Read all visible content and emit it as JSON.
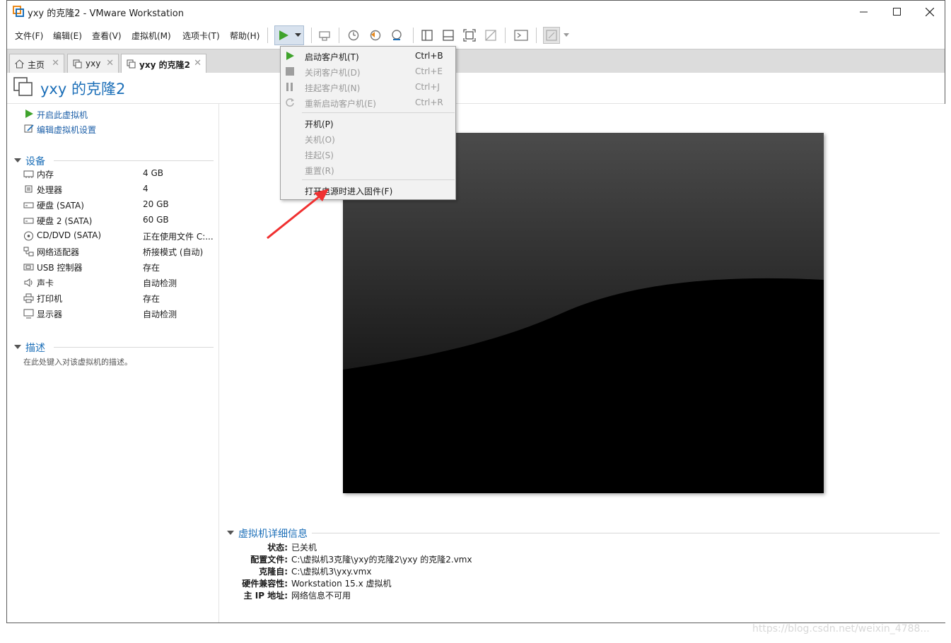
{
  "window": {
    "title": "yxy 的克隆2 - VMware Workstation",
    "minimize": "—",
    "maximize": "☐",
    "close": "✕"
  },
  "menubar": {
    "items": [
      "文件(F)",
      "编辑(E)",
      "查看(V)",
      "虚拟机(M)",
      "选项卡(T)",
      "帮助(H)"
    ]
  },
  "tabs": [
    {
      "label": "主页",
      "close": "✕"
    },
    {
      "label": "yxy",
      "close": "✕"
    },
    {
      "label": "yxy 的克隆2",
      "close": "✕"
    }
  ],
  "vm": {
    "title": "yxy 的克隆2"
  },
  "actions": {
    "power_on": "开启此虚拟机",
    "edit_settings": "编辑虚拟机设置"
  },
  "devices": {
    "heading": "设备",
    "rows": [
      {
        "name": "内存",
        "value": "4 GB",
        "icon": "memory-icon"
      },
      {
        "name": "处理器",
        "value": "4",
        "icon": "cpu-icon"
      },
      {
        "name": "硬盘 (SATA)",
        "value": "20 GB",
        "icon": "disk-icon"
      },
      {
        "name": "硬盘 2 (SATA)",
        "value": "60 GB",
        "icon": "disk-icon"
      },
      {
        "name": "CD/DVD (SATA)",
        "value": "正在使用文件 C:...",
        "icon": "cd-icon"
      },
      {
        "name": "网络适配器",
        "value": "桥接模式 (自动)",
        "icon": "network-icon"
      },
      {
        "name": "USB 控制器",
        "value": "存在",
        "icon": "usb-icon"
      },
      {
        "name": "声卡",
        "value": "自动检测",
        "icon": "sound-icon"
      },
      {
        "name": "打印机",
        "value": "存在",
        "icon": "printer-icon"
      },
      {
        "name": "显示器",
        "value": "自动检测",
        "icon": "monitor-icon"
      }
    ]
  },
  "description": {
    "heading": "描述",
    "placeholder": "在此处键入对该虚拟机的描述。"
  },
  "details": {
    "heading": "虚拟机详细信息",
    "rows": [
      {
        "key": "状态:",
        "value": "已关机"
      },
      {
        "key": "配置文件:",
        "value": "C:\\虚拟机3克隆\\yxy的克隆2\\yxy 的克隆2.vmx"
      },
      {
        "key": "克隆自:",
        "value": "C:\\虚拟机3\\yxy.vmx"
      },
      {
        "key": "硬件兼容性:",
        "value": "Workstation 15.x 虚拟机"
      },
      {
        "key": "主 IP 地址:",
        "value": "网络信息不可用"
      }
    ]
  },
  "power_menu": {
    "group1": [
      {
        "label": "启动客户机(T)",
        "shortcut": "Ctrl+B",
        "enabled": true,
        "icon": "play-icon"
      },
      {
        "label": "关闭客户机(D)",
        "shortcut": "Ctrl+E",
        "enabled": false,
        "icon": "stop-icon"
      },
      {
        "label": "挂起客户机(N)",
        "shortcut": "Ctrl+J",
        "enabled": false,
        "icon": "pause-icon"
      },
      {
        "label": "重新启动客户机(E)",
        "shortcut": "Ctrl+R",
        "enabled": false,
        "icon": "restart-icon"
      }
    ],
    "group2": [
      {
        "label": "开机(P)",
        "enabled": true
      },
      {
        "label": "关机(O)",
        "enabled": false
      },
      {
        "label": "挂起(S)",
        "enabled": false
      },
      {
        "label": "重置(R)",
        "enabled": false
      }
    ],
    "group3": [
      {
        "label": "打开电源时进入固件(F)",
        "enabled": true
      }
    ]
  },
  "watermark": "https://blog.csdn.net/weixin_4788..."
}
